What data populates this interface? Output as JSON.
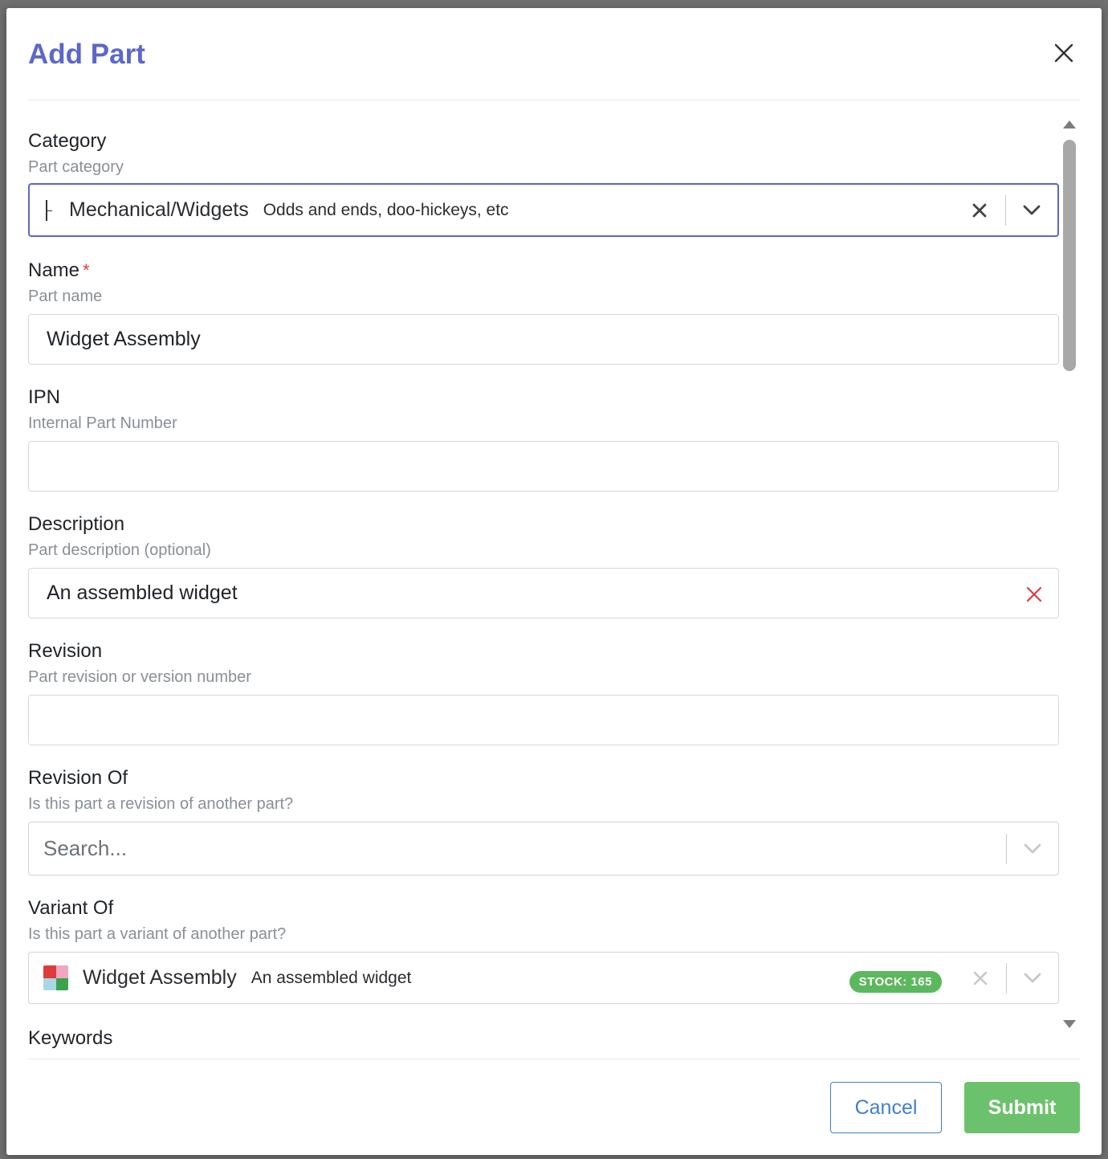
{
  "dialog": {
    "title": "Add Part"
  },
  "fields": {
    "category": {
      "label": "Category",
      "help": "Part category",
      "value": "Mechanical/Widgets",
      "value_description": "Odds and ends, doo-hickeys, etc"
    },
    "name": {
      "label": "Name",
      "required_mark": "*",
      "help": "Part name",
      "value": "Widget Assembly"
    },
    "ipn": {
      "label": "IPN",
      "help": "Internal Part Number",
      "value": ""
    },
    "description": {
      "label": "Description",
      "help": "Part description (optional)",
      "value": "An assembled widget"
    },
    "revision": {
      "label": "Revision",
      "help": "Part revision or version number",
      "value": ""
    },
    "revision_of": {
      "label": "Revision Of",
      "help": "Is this part a revision of another part?",
      "placeholder": "Search..."
    },
    "variant_of": {
      "label": "Variant Of",
      "help": "Is this part a variant of another part?",
      "value": "Widget Assembly",
      "value_description": "An assembled widget",
      "stock_badge": "STOCK: 165"
    },
    "keywords": {
      "label": "Keywords"
    }
  },
  "footer": {
    "cancel_label": "Cancel",
    "submit_label": "Submit"
  },
  "colors": {
    "title": "#5c67c9",
    "focus_border": "#5c67c9",
    "submit": "#6cc26c",
    "cancel": "#3f7fd1",
    "badge": "#5cb85c",
    "error_clear": "#e03b3b"
  }
}
